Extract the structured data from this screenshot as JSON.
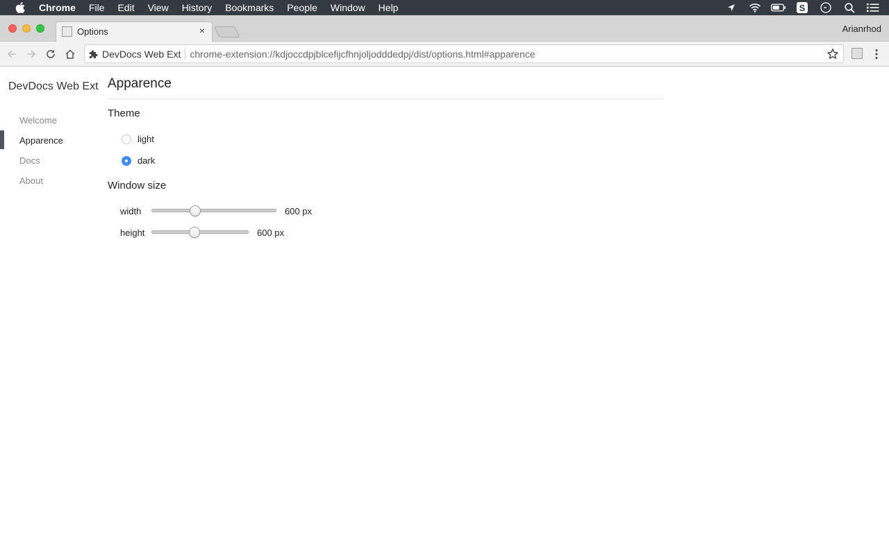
{
  "menubar": {
    "app_name": "Chrome",
    "items": [
      "File",
      "Edit",
      "View",
      "History",
      "Bookmarks",
      "People",
      "Window",
      "Help"
    ],
    "status_icons": [
      "location-icon",
      "wifi-icon",
      "battery-icon",
      "s-app-icon",
      "timer-icon",
      "spotlight-search-icon",
      "notification-center-icon"
    ]
  },
  "browser": {
    "tab": {
      "title": "Options",
      "close": "×"
    },
    "profile_name": "Arianrhod",
    "omnibox": {
      "origin_label": "DevDocs Web Ext",
      "url": "chrome-extension://kdjoccdpjblcefijcfhnjoljodddedpj/dist/options.html#apparence"
    }
  },
  "sidebar": {
    "brand": "DevDocs Web Ext",
    "items": [
      {
        "label": "Welcome",
        "active": false
      },
      {
        "label": "Apparence",
        "active": true
      },
      {
        "label": "Docs",
        "active": false
      },
      {
        "label": "About",
        "active": false
      }
    ]
  },
  "main": {
    "title": "Apparence",
    "theme": {
      "heading": "Theme",
      "options": [
        {
          "label": "light",
          "checked": false
        },
        {
          "label": "dark",
          "checked": true
        }
      ]
    },
    "window_size": {
      "heading": "Window size",
      "sliders": [
        {
          "label": "width",
          "value": 600,
          "unit": "px",
          "value_text": "600 px",
          "fraction": 0.35
        },
        {
          "label": "height",
          "value": 600,
          "unit": "px",
          "value_text": "600 px",
          "fraction": 0.44
        }
      ]
    }
  },
  "colors": {
    "accent": "#3e8ef0",
    "menubar_bg": "#343a42",
    "active_indicator": "#4f5660"
  }
}
